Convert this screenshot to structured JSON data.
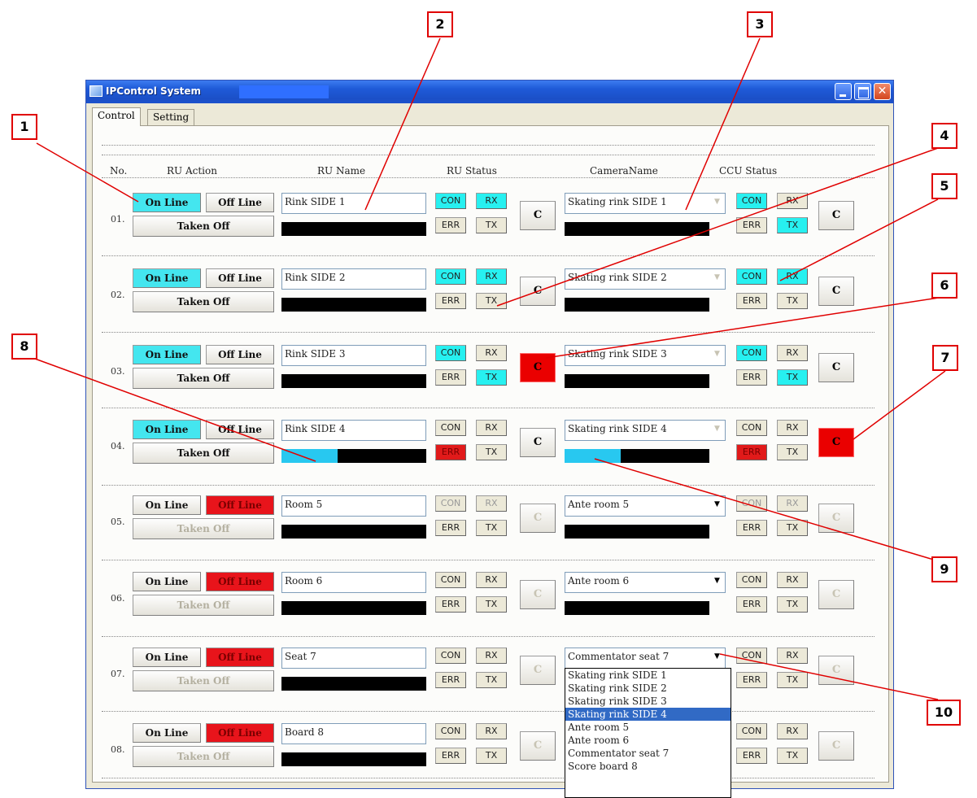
{
  "window": {
    "title": "IPControl System"
  },
  "tabs": [
    {
      "label": "Control"
    },
    {
      "label": "Setting"
    }
  ],
  "headers": {
    "no": "No.",
    "ru_action": "RU Action",
    "ru_name": "RU Name",
    "ru_status": "RU Status",
    "camera_name": "CameraName",
    "ccu_status": "CCU Status"
  },
  "labels": {
    "on_line": "On Line",
    "off_line": "Off Line",
    "taken_off": "Taken Off",
    "con": "CON",
    "rx": "RX",
    "err": "ERR",
    "tx": "TX",
    "c": "C"
  },
  "rows": [
    {
      "no": "01.",
      "ru_name": "Rink SIDE 1",
      "camera_name": "Skating rink SIDE 1"
    },
    {
      "no": "02.",
      "ru_name": "Rink SIDE 2",
      "camera_name": "Skating rink SIDE 2"
    },
    {
      "no": "03.",
      "ru_name": "Rink SIDE 3",
      "camera_name": "Skating rink SIDE 3"
    },
    {
      "no": "04.",
      "ru_name": "Rink SIDE 4",
      "camera_name": "Skating rink SIDE 4",
      "ru_progress": 0.39,
      "ccu_progress": 0.39
    },
    {
      "no": "05.",
      "ru_name": "Room 5",
      "camera_name": "Ante room 5"
    },
    {
      "no": "06.",
      "ru_name": "Room 6",
      "camera_name": "Ante room 6"
    },
    {
      "no": "07.",
      "ru_name": "Seat 7",
      "camera_name": "Commentator seat 7"
    },
    {
      "no": "08.",
      "ru_name": "Board 8",
      "camera_name": ""
    }
  ],
  "dropdown": {
    "options": [
      "Skating rink SIDE 1",
      "Skating rink SIDE 2",
      "Skating rink SIDE 3",
      "Skating rink SIDE 4",
      "Ante room 5",
      "Ante room 6",
      "Commentator seat 7",
      "Score board 8"
    ],
    "highlighted": "Skating rink SIDE 4"
  },
  "callouts": [
    "1",
    "2",
    "3",
    "4",
    "5",
    "6",
    "7",
    "8",
    "9",
    "10"
  ],
  "colors": {
    "online": "#44e6ef",
    "offline": "#e8141b",
    "status_on": "#27f0f0",
    "status_err": "#e11a1a",
    "progress": "#28c8f0",
    "callout": "#e00000"
  }
}
